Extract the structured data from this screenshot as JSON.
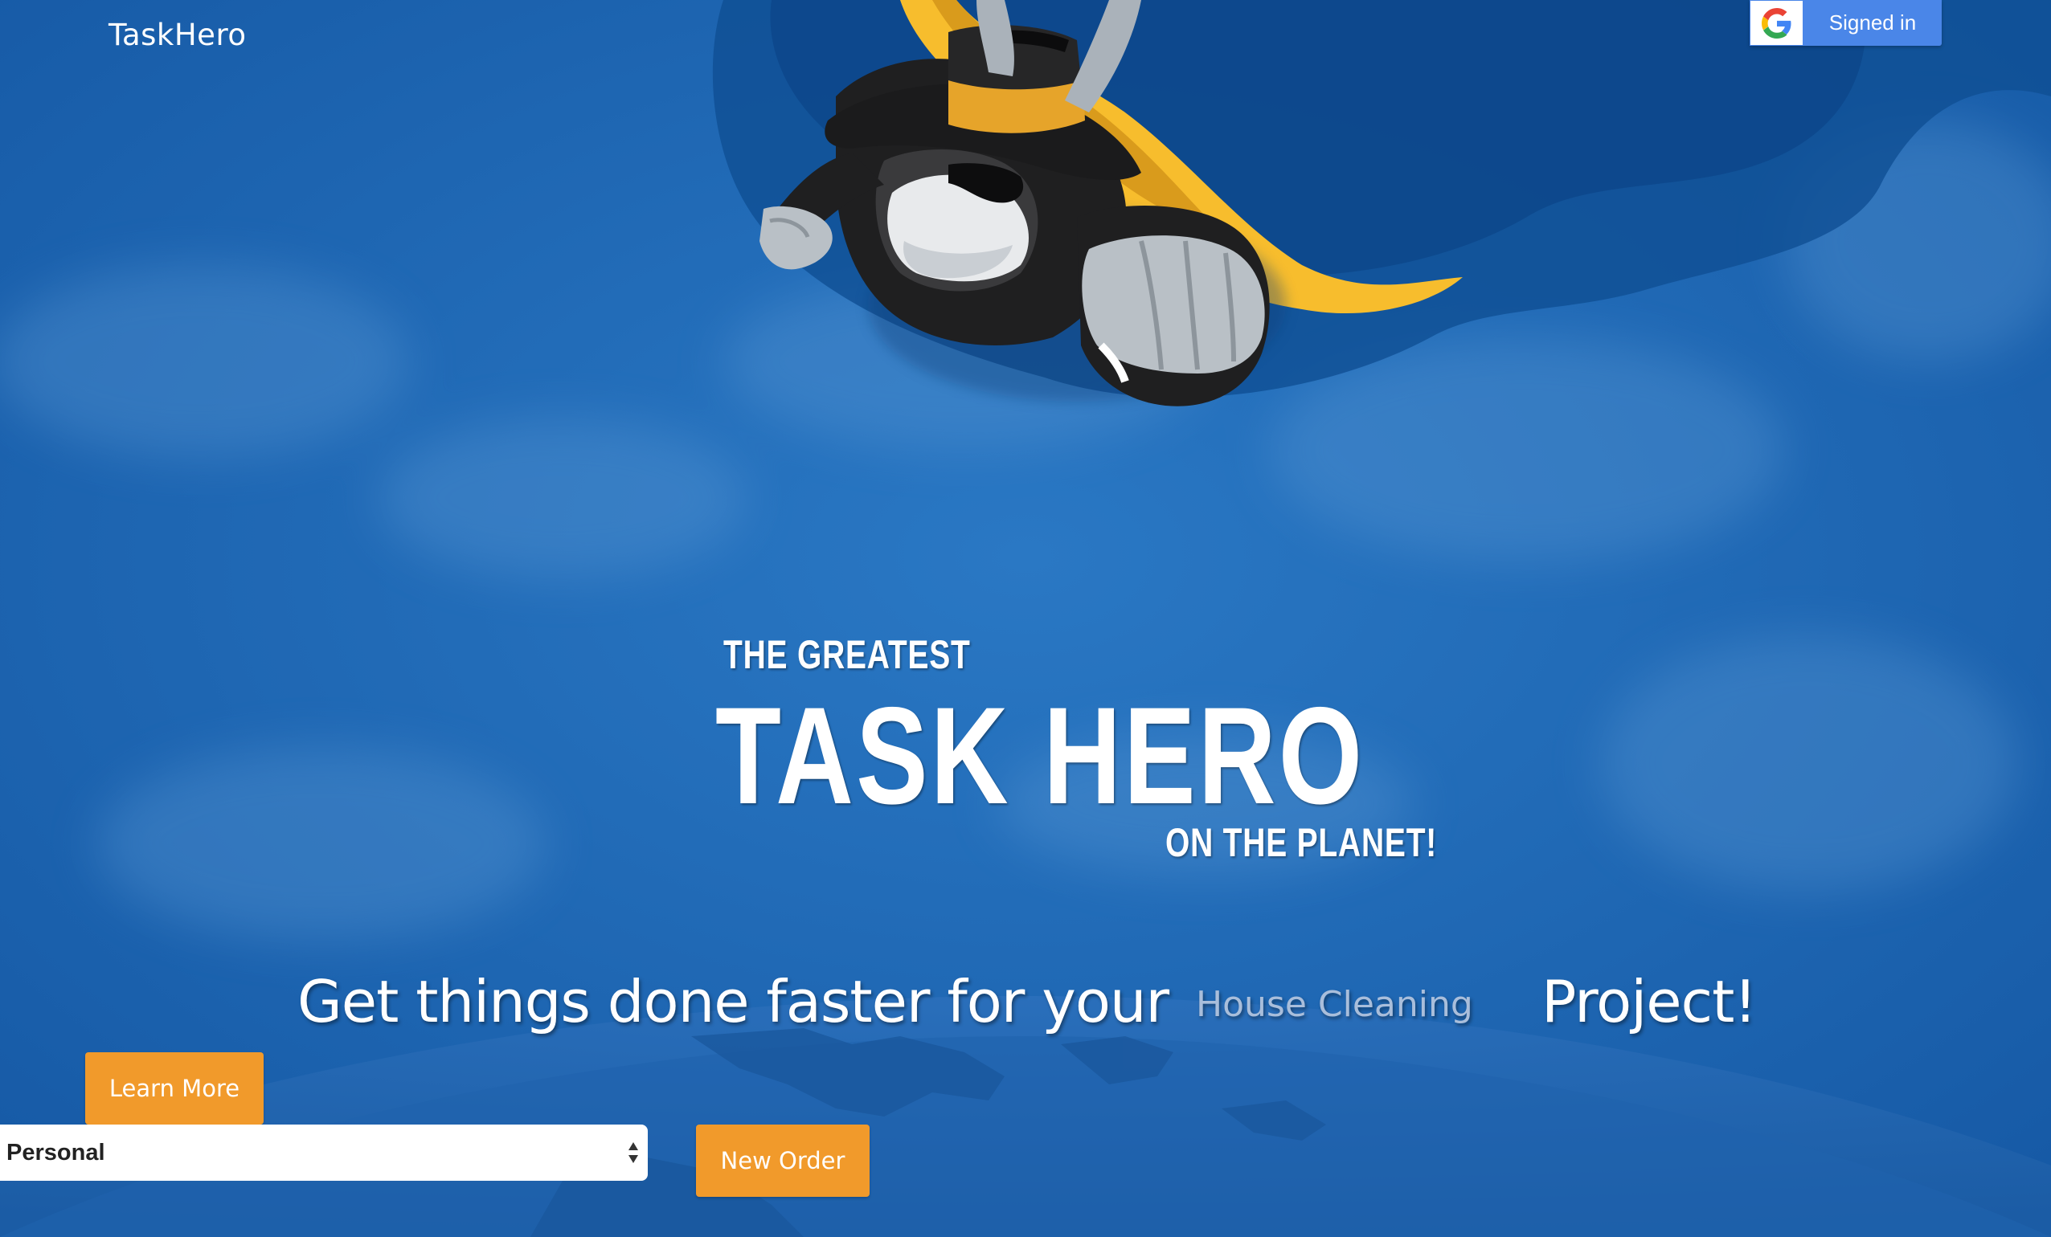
{
  "brand": {
    "name": "TaskHero"
  },
  "google_signin": {
    "label": "Signed in",
    "icon": "google-g-icon"
  },
  "hero": {
    "line1": "THE GREATEST",
    "line2": "TASK HERO",
    "line3": "ON THE PLANET!"
  },
  "tagline": {
    "prefix": "Get things done faster for your",
    "rotating_word": "House Cleaning",
    "suffix": "Project!"
  },
  "buttons": {
    "learn_more": "Learn More",
    "new_order": "New Order"
  },
  "order_type_select": {
    "selected": "Personal"
  },
  "colors": {
    "background": "#1a64b0",
    "accent_orange": "#f19a2b",
    "google_blue": "#4a86e8",
    "cape_yellow": "#f7bd2d"
  }
}
